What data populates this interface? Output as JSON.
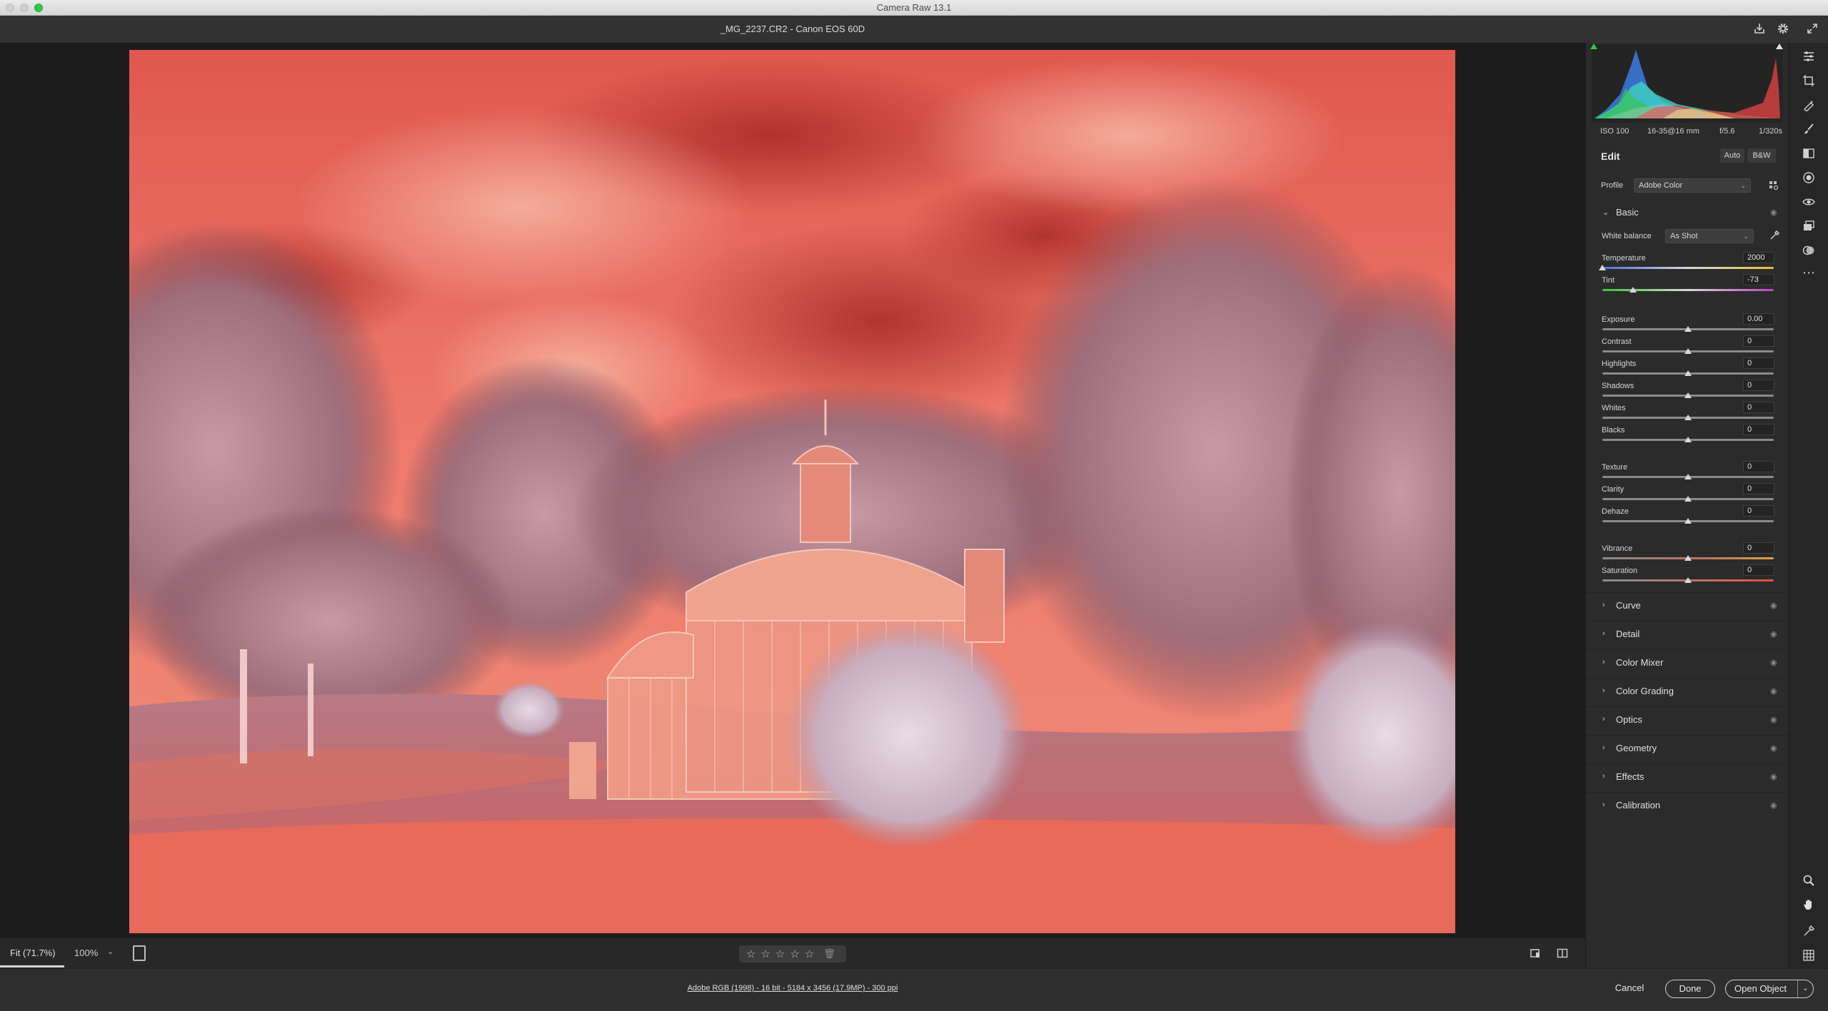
{
  "window": {
    "app_title": "Camera Raw 13.1"
  },
  "header": {
    "file_title": "_MG_2237.CR2  -  Canon EOS 60D"
  },
  "histogram": {
    "exif": {
      "iso": "ISO 100",
      "lens": "16-35@16 mm",
      "aperture": "f/5.6",
      "shutter": "1/320s"
    }
  },
  "edit": {
    "title": "Edit",
    "auto_label": "Auto",
    "bw_label": "B&W",
    "profile_label": "Profile",
    "profile_value": "Adobe Color"
  },
  "basic": {
    "title": "Basic",
    "wb_label": "White balance",
    "wb_value": "As Shot",
    "sliders": [
      {
        "label": "Temperature",
        "value": "2000",
        "level": 0.0
      },
      {
        "label": "Tint",
        "value": "-73",
        "level": 0.18
      },
      {
        "label": "Exposure",
        "value": "0.00",
        "level": 0.5
      },
      {
        "label": "Contrast",
        "value": "0",
        "level": 0.5
      },
      {
        "label": "Highlights",
        "value": "0",
        "level": 0.5
      },
      {
        "label": "Shadows",
        "value": "0",
        "level": 0.5
      },
      {
        "label": "Whites",
        "value": "0",
        "level": 0.5
      },
      {
        "label": "Blacks",
        "value": "0",
        "level": 0.5
      },
      {
        "label": "Texture",
        "value": "0",
        "level": 0.5
      },
      {
        "label": "Clarity",
        "value": "0",
        "level": 0.5
      },
      {
        "label": "Dehaze",
        "value": "0",
        "level": 0.5
      },
      {
        "label": "Vibrance",
        "value": "0",
        "level": 0.5
      },
      {
        "label": "Saturation",
        "value": "0",
        "level": 0.5
      }
    ]
  },
  "sections": [
    {
      "label": "Curve"
    },
    {
      "label": "Detail"
    },
    {
      "label": "Color Mixer"
    },
    {
      "label": "Color Grading"
    },
    {
      "label": "Optics"
    },
    {
      "label": "Geometry"
    },
    {
      "label": "Effects"
    },
    {
      "label": "Calibration"
    }
  ],
  "bottom": {
    "zoom_fit": "Fit (71.7%)",
    "zoom_100": "100%",
    "workflow": "Adobe RGB (1998) - 16 bit - 5184 x 3456 (17.9MP) - 300 ppi"
  },
  "actions": {
    "cancel": "Cancel",
    "done": "Done",
    "open": "Open Object"
  },
  "colors": {
    "accent_green": "#30c748",
    "photo_sky": "#e8685c",
    "panel_bg": "#2b2b2b"
  }
}
